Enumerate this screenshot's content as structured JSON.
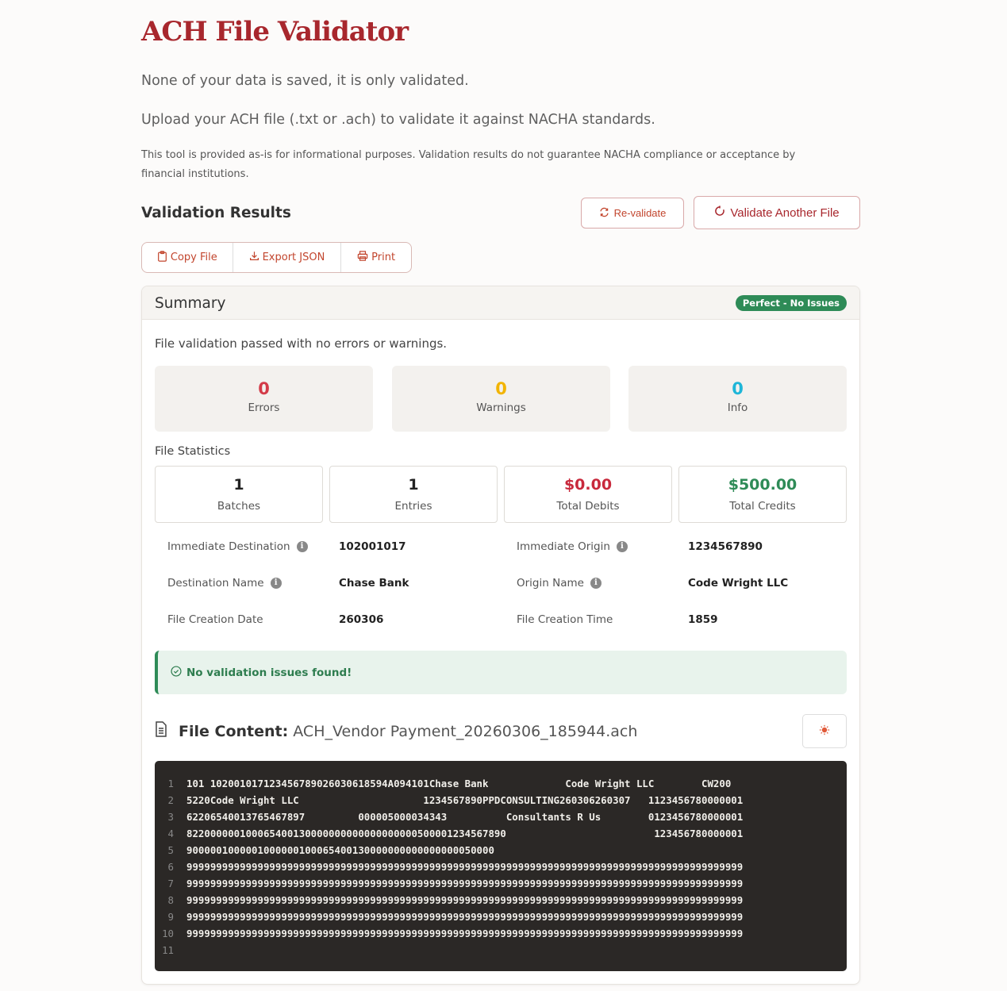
{
  "header": {
    "title": "ACH File Validator",
    "lead1": "None of your data is saved, it is only validated.",
    "lead2": "Upload your ACH file (.txt or .ach) to validate it against NACHA standards.",
    "disclaimer": "This tool is provided as-is for informational purposes. Validation results do not guarantee NACHA compliance or acceptance by financial institutions."
  },
  "results": {
    "title": "Validation Results",
    "revalidate_label": "Re-validate",
    "another_label": "Validate Another File",
    "copy_label": "Copy File",
    "export_label": "Export JSON",
    "print_label": "Print"
  },
  "summary": {
    "title": "Summary",
    "badge": "Perfect - No Issues",
    "message": "File validation passed with no errors or warnings.",
    "counts": [
      {
        "value": "0",
        "label": "Errors"
      },
      {
        "value": "0",
        "label": "Warnings"
      },
      {
        "value": "0",
        "label": "Info"
      }
    ],
    "stats_title": "File Statistics",
    "stats": [
      {
        "value": "1",
        "label": "Batches"
      },
      {
        "value": "1",
        "label": "Entries"
      },
      {
        "value": "$0.00",
        "label": "Total Debits"
      },
      {
        "value": "$500.00",
        "label": "Total Credits"
      }
    ],
    "details": [
      {
        "label": "Immediate Destination",
        "value": "102001017",
        "info": true
      },
      {
        "label": "Immediate Origin",
        "value": "1234567890",
        "info": true
      },
      {
        "label": "Destination Name",
        "value": "Chase Bank",
        "info": true
      },
      {
        "label": "Origin Name",
        "value": "Code Wright LLC",
        "info": true
      },
      {
        "label": "File Creation Date",
        "value": "260306",
        "info": false
      },
      {
        "label": "File Creation Time",
        "value": "1859",
        "info": false
      }
    ],
    "success_message": "No validation issues found!"
  },
  "file_content": {
    "label": "File Content:",
    "filename": "ACH_Vendor Payment_20260306_185944.ach",
    "lines": [
      "101 102001017123456789026030618594A094101Chase Bank             Code Wright LLC        CW200",
      "5220Code Wright LLC                     1234567890PPDCONSULTING260306260307   1123456780000001",
      "62206540013765467897         000005000034343          Consultants R Us        0123456780000001",
      "822000000100065400130000000000000000000500001234567890                         123456780000001",
      "9000001000001000000100065400130000000000000000050000",
      "9999999999999999999999999999999999999999999999999999999999999999999999999999999999999999999999",
      "9999999999999999999999999999999999999999999999999999999999999999999999999999999999999999999999",
      "9999999999999999999999999999999999999999999999999999999999999999999999999999999999999999999999",
      "9999999999999999999999999999999999999999999999999999999999999999999999999999999999999999999999",
      "9999999999999999999999999999999999999999999999999999999999999999999999999999999999999999999999",
      ""
    ]
  },
  "colors": {
    "brand": "#a8272d",
    "success": "#2e8b57",
    "error": "#d33b48",
    "warning": "#f2b400",
    "info": "#1eb6d8"
  }
}
